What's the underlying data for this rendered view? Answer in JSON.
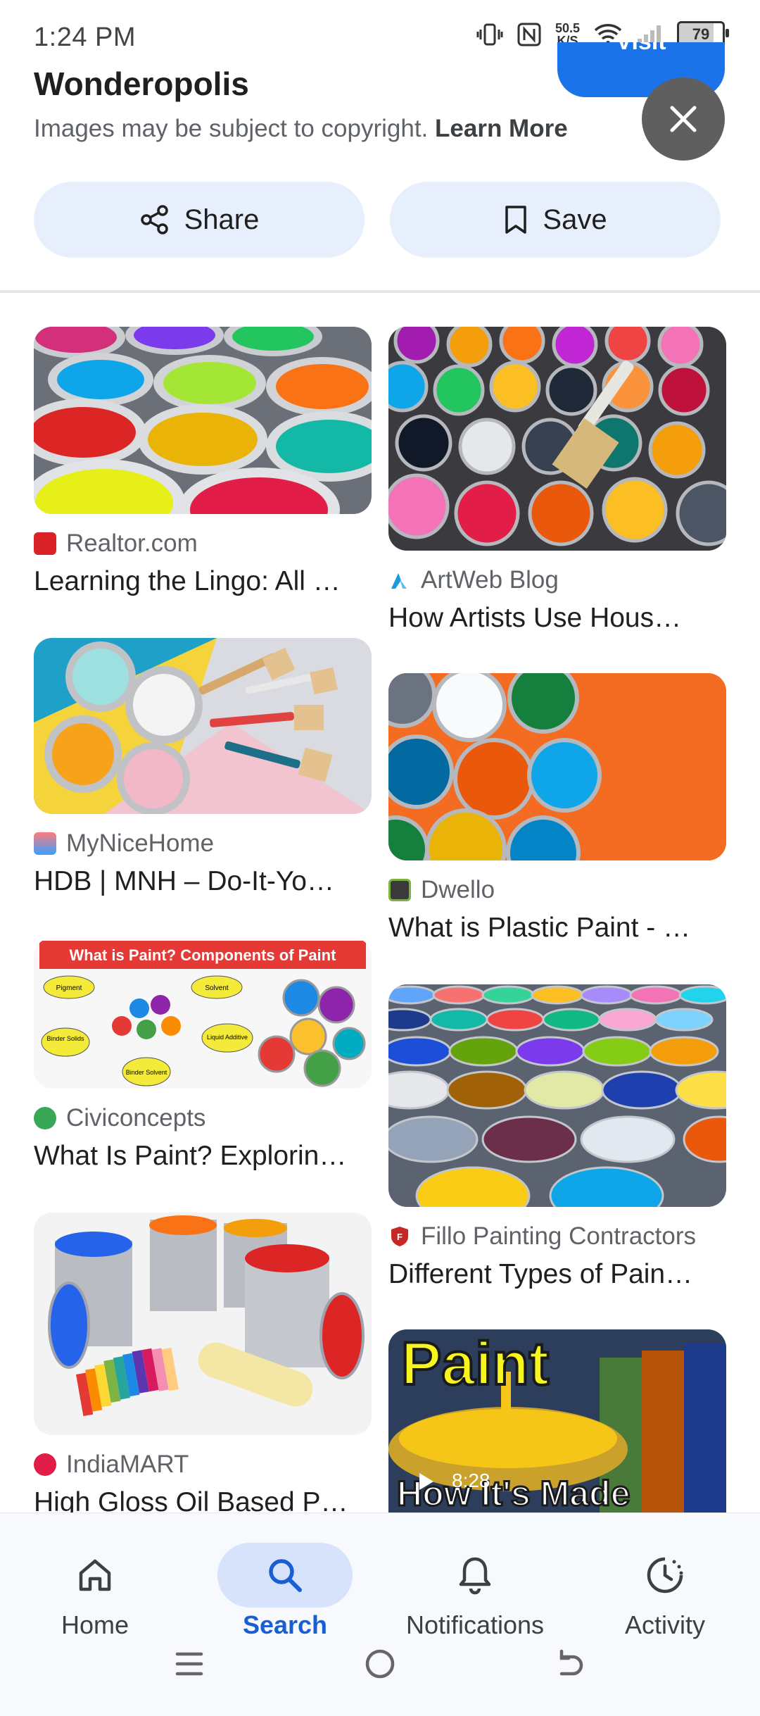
{
  "status_bar": {
    "time": "1:24 PM",
    "speed_top": "50.5",
    "speed_bottom": "K/S",
    "battery": "79"
  },
  "header": {
    "site_title": "Wonderopolis",
    "copyright_text": "Images may be subject to copyright.",
    "learn_more": "Learn More",
    "visit_label": "Visit"
  },
  "actions": {
    "share_label": "Share",
    "save_label": "Save"
  },
  "results": [
    {
      "source": "Realtor.com",
      "title": "Learning the Lingo: All …"
    },
    {
      "source": "ArtWeb Blog",
      "title": "How Artists Use Hous…"
    },
    {
      "source": "MyNiceHome",
      "title": "HDB | MNH – Do-It-Yo…"
    },
    {
      "source": "Dwello",
      "title": "What is Plastic Paint - …"
    },
    {
      "source": "Civiconcepts",
      "title": "What Is Paint? Explorin…"
    },
    {
      "source": "Fillo Painting Contractors",
      "title": "Different Types of Pain…"
    },
    {
      "source": "IndiaMART",
      "title": "High Gloss Oil Based P…"
    }
  ],
  "thumb_text": {
    "paint_components_heading": "What is Paint? Components of Paint",
    "pigment": "Pigment",
    "solvent": "Solvent",
    "binder_solids": "Binder Solids",
    "liquid_additive": "Liquid Additive",
    "binder_solvent": "Binder Solvent",
    "video_title_top": "Paint",
    "video_title_bottom": "How It's Made",
    "video_duration": "8:28"
  },
  "bottom_nav": [
    {
      "label": "Home"
    },
    {
      "label": "Search"
    },
    {
      "label": "Notifications"
    },
    {
      "label": "Activity"
    }
  ],
  "colors": {
    "accent": "#1a73e8",
    "pill_bg": "#e8effc",
    "nav_active": "#d6e3fb"
  }
}
